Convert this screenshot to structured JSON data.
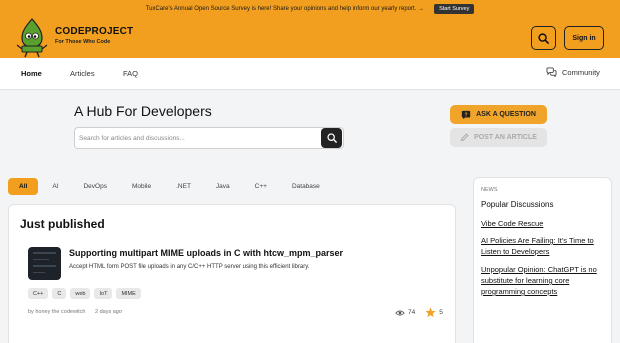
{
  "banner": {
    "message": "TuxCare's Annual Open Source Survey is here! Share your opinions and help inform our yearly report. →",
    "button": "Start Survey"
  },
  "header": {
    "logo_text": "CODEPROJECT",
    "logo_sub": "For Those Who Code",
    "signin": "Sign in"
  },
  "nav": {
    "items": [
      "Home",
      "Articles",
      "FAQ"
    ],
    "community": "Community"
  },
  "hero": {
    "title": "A Hub For Developers",
    "search_placeholder": "Search for articles and discussions...",
    "ask_button": "ASK A QUESTION",
    "post_button": "POST AN ARTICLE"
  },
  "filters": [
    "All",
    "AI",
    "DevOps",
    "Mobile",
    ".NET",
    "Java",
    "C++",
    "Database"
  ],
  "published": {
    "heading": "Just published",
    "article": {
      "title": "Supporting multipart MIME uploads in C with htcw_mpm_parser",
      "description": "Accept HTML form POST file uploads in any C/C++ HTTP server using this efficient library.",
      "tags": [
        "C++",
        "C",
        "web",
        "IoT",
        "MIME"
      ],
      "author": "by honey the codewitch",
      "date": "2 days ago",
      "views": "74",
      "stars": "5"
    }
  },
  "news": {
    "label": "NEWS",
    "heading": "Popular Discussions",
    "links": [
      "Vibe Code Rescue",
      "AI Policies Are Failing: It's Time to Listen to Developers",
      "Unpopular Opinion: ChatGPT is no substitute for learning core programming concepts"
    ]
  },
  "colors": {
    "brand_orange": "#f29f1f",
    "dark": "#222222"
  }
}
